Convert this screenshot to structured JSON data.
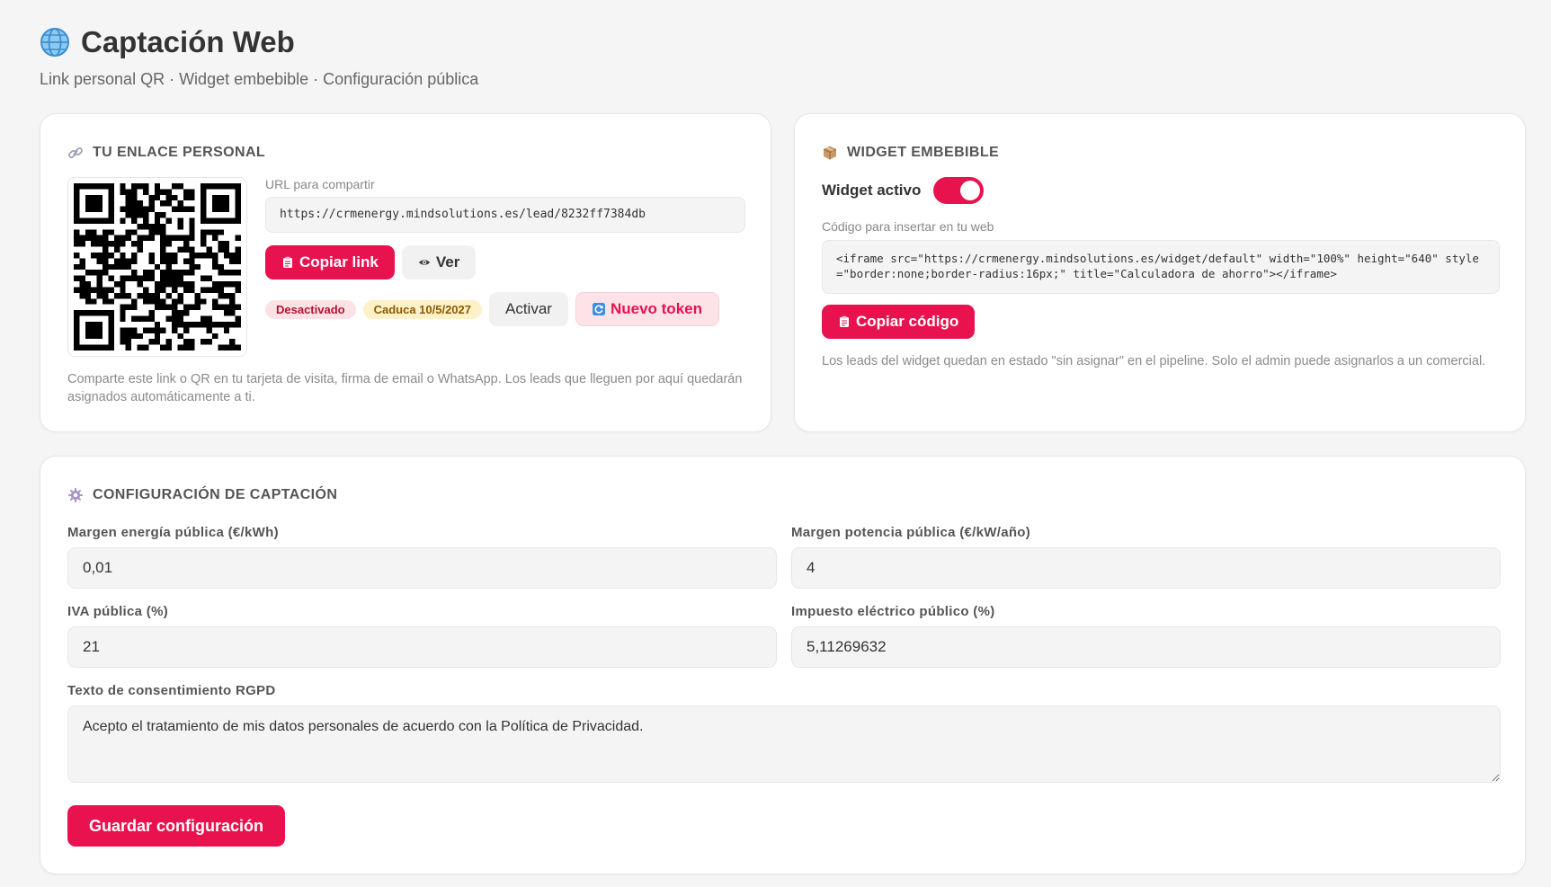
{
  "header": {
    "title": "Captación Web",
    "subtitle": "Link personal QR · Widget embebible · Configuración pública"
  },
  "colors": {
    "accent": "#e8124f",
    "badge_red_bg": "#fde2e5",
    "badge_yellow_bg": "#fdf1c7"
  },
  "personal_link": {
    "title": "Tu enlace personal",
    "url_label": "URL para compartir",
    "url_value": "https://crmenergy.mindsolutions.es/lead/8232ff7384db",
    "copy_label": "Copiar link",
    "view_label": "Ver",
    "status_badge": "Desactivado",
    "expiry_badge": "Caduca 10/5/2027",
    "activate_label": "Activar",
    "new_token_label": "Nuevo token",
    "note": "Comparte este link o QR en tu tarjeta de visita, firma de email o WhatsApp. Los leads que lleguen por aquí quedarán asignados automáticamente a ti."
  },
  "widget": {
    "title": "Widget embebible",
    "active_label": "Widget activo",
    "active": true,
    "code_label": "Código para insertar en tu web",
    "code_value": "<iframe src=\"https://crmenergy.mindsolutions.es/widget/default\" width=\"100%\" height=\"640\" style=\"border:none;border-radius:16px;\" title=\"Calculadora de ahorro\"></iframe>",
    "copy_code_label": "Copiar código",
    "note": "Los leads del widget quedan en estado \"sin asignar\" en el pipeline. Solo el admin puede asignarlos a un comercial."
  },
  "config": {
    "title": "Configuración de captación",
    "energy_margin_label": "Margen energía pública (€/kWh)",
    "energy_margin_value": "0,01",
    "power_margin_label": "Margen potencia pública (€/kW/año)",
    "power_margin_value": "4",
    "vat_label": "IVA pública (%)",
    "vat_value": "21",
    "electric_tax_label": "Impuesto eléctrico público (%)",
    "electric_tax_value": "5,11269632",
    "consent_label": "Texto de consentimiento RGPD",
    "consent_value": "Acepto el tratamiento de mis datos personales de acuerdo con la Política de Privacidad.",
    "save_label": "Guardar configuración"
  },
  "icons": {
    "header": "globe-icon",
    "personal_link": "link-icon",
    "widget": "package-icon",
    "config": "gear-icon",
    "copy": "clipboard-icon",
    "view": "eye-icon",
    "new_token": "refresh-icon",
    "qr": "qr-code"
  }
}
